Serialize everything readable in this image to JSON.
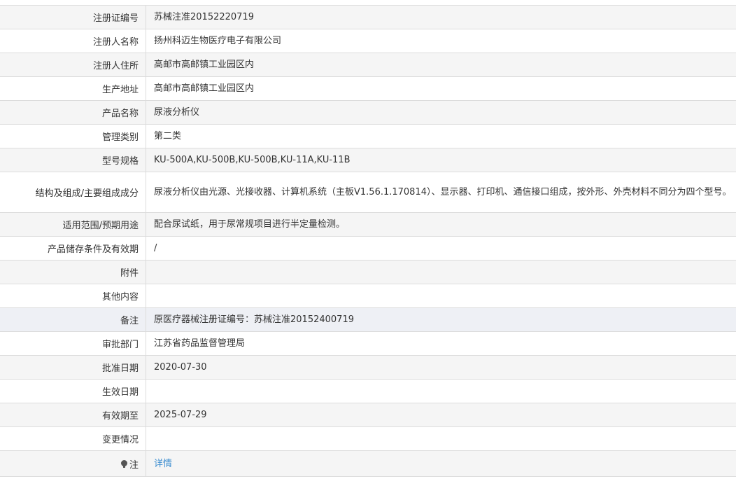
{
  "record": {
    "reg_no_label": "注册证编号",
    "reg_no": "苏械注准20152220719",
    "registrant_label": "注册人名称",
    "registrant": "扬州科迈生物医疗电子有限公司",
    "registrant_addr_label": "注册人住所",
    "registrant_addr": "高邮市高邮镇工业园区内",
    "prod_addr_label": "生产地址",
    "prod_addr": "高邮市高邮镇工业园区内",
    "product_name_label": "产品名称",
    "product_name": "尿液分析仪",
    "category_label": "管理类别",
    "category": "第二类",
    "model_label": "型号规格",
    "model": "KU-500A,KU-500B,KU-500B,KU-11A,KU-11B",
    "structure_label": "结构及组成/主要组成成分",
    "structure": "尿液分析仪由光源、光接收器、计算机系统（主板V1.56.1.170814）、显示器、打印机、通信接口组成，按外形、外壳材料不同分为四个型号。",
    "usage_label": "适用范围/预期用途",
    "usage": "配合尿试纸，用于尿常规项目进行半定量检测。",
    "storage_label": "产品储存条件及有效期",
    "storage": "/",
    "attachment_label": "附件",
    "attachment": "",
    "other_label": "其他内容",
    "other": "",
    "remark_label": "备注",
    "remark": "原医疗器械注册证编号：苏械注准20152400719",
    "dept_label": "审批部门",
    "dept": "江苏省药品监督管理局",
    "approve_date_label": "批准日期",
    "approve_date": "2020-07-30",
    "effective_date_label": "生效日期",
    "effective_date": "",
    "valid_until_label": "有效期至",
    "valid_until": "2025-07-29",
    "change_label": "变更情况",
    "change": "",
    "note_label": "注",
    "note_link": "详情"
  },
  "icons": {
    "note_icon": "lightbulb-icon"
  },
  "colors": {
    "link": "#3c8dd0",
    "border": "#dcdcdc",
    "alt_row": "#f5f5f5",
    "highlight_row": "#eef0f5"
  }
}
